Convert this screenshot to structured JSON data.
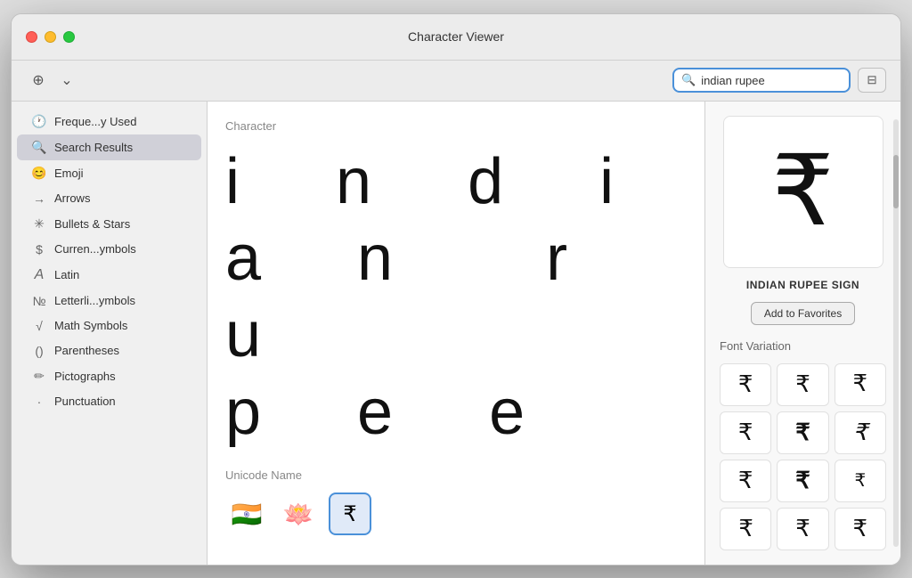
{
  "window": {
    "title": "Character Viewer"
  },
  "toolbar": {
    "add_btn": "⊕",
    "chevron_btn": "⌄",
    "search_placeholder": "indian rupee",
    "search_value": "indian rupee",
    "grid_icon": "⊞"
  },
  "sidebar": {
    "items": [
      {
        "id": "frequently-used",
        "icon": "🕐",
        "label": "Freque...y Used",
        "active": false
      },
      {
        "id": "search-results",
        "icon": "🔍",
        "label": "Search Results",
        "active": true
      },
      {
        "id": "emoji",
        "icon": "😊",
        "label": "Emoji",
        "active": false
      },
      {
        "id": "arrows",
        "icon": "→",
        "label": "Arrows",
        "active": false
      },
      {
        "id": "bullets-stars",
        "icon": "✳",
        "label": "Bullets & Stars",
        "active": false
      },
      {
        "id": "currency-symbols",
        "icon": "$",
        "label": "Curren...ymbols",
        "active": false
      },
      {
        "id": "latin",
        "icon": "A",
        "label": "Latin",
        "active": false
      },
      {
        "id": "letterlike-symbols",
        "icon": "№",
        "label": "Letterli...ymbols",
        "active": false
      },
      {
        "id": "math-symbols",
        "icon": "√",
        "label": "Math Symbols",
        "active": false
      },
      {
        "id": "parentheses",
        "icon": "()",
        "label": "Parentheses",
        "active": false
      },
      {
        "id": "pictographs",
        "icon": "✏",
        "label": "Pictographs",
        "active": false
      },
      {
        "id": "punctuation",
        "icon": "·",
        "label": "Punctuation",
        "active": false
      }
    ]
  },
  "main": {
    "character_label": "Character",
    "char_display_text": "i n d i a n   r u p e e",
    "unicode_name_label": "Unicode Name",
    "char_items": [
      {
        "char": "🇮🇳",
        "selected": false,
        "label": "India Flag"
      },
      {
        "char": "🪷",
        "selected": false,
        "label": "Lotus"
      },
      {
        "char": "₹",
        "selected": true,
        "label": "Indian Rupee Sign"
      }
    ]
  },
  "right_panel": {
    "char_name": "INDIAN RUPEE SIGN",
    "add_favorites_label": "Add to Favorites",
    "font_variation_label": "Font Variation",
    "font_variations": [
      "₹",
      "₹",
      "₹",
      "₹",
      "₹",
      "₹",
      "₹",
      "₹",
      "₹",
      "₹",
      "₹",
      "₹"
    ]
  }
}
